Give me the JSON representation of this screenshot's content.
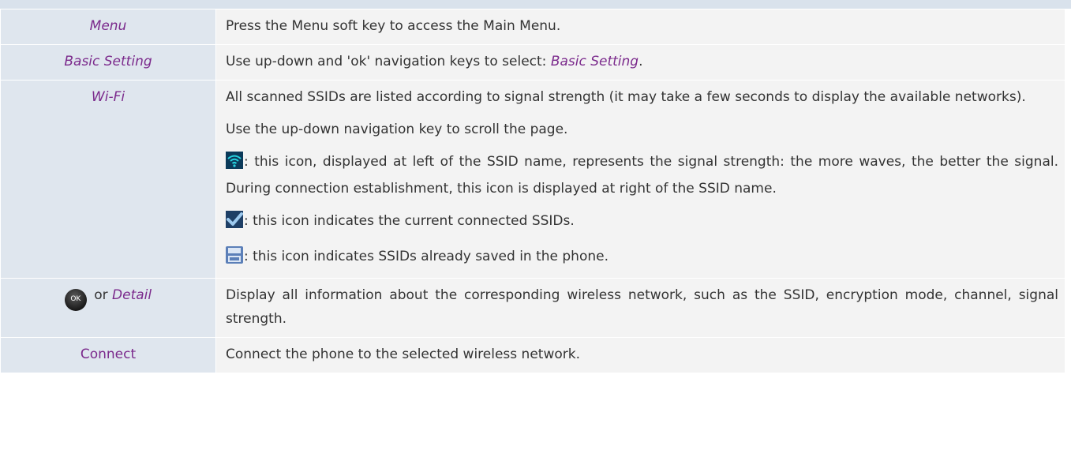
{
  "rows": {
    "menu": {
      "key": "Menu",
      "desc": "Press the Menu soft key to access the Main Menu."
    },
    "basic": {
      "key": "Basic Setting",
      "desc_prefix": "Use up-down and 'ok' navigation keys to select: ",
      "desc_emph": "Basic Setting",
      "desc_suffix": "."
    },
    "wifi": {
      "key": "Wi-Fi",
      "p1": "All scanned SSIDs are listed according to signal strength (it may take a few seconds to display the available networks).",
      "p2": "Use the up-down navigation key to scroll the page.",
      "p3": ": this icon, displayed at left of the SSID name, represents the signal strength: the more waves, the better the signal. During connection establishment, this icon is displayed at right of the SSID name.",
      "p4": ": this icon indicates the current connected SSIDs.",
      "p5": ": this icon indicates SSIDs already saved in the phone."
    },
    "detail": {
      "ok_label": "OK",
      "or": "or",
      "key": "Detail",
      "desc": "Display all information about the corresponding wireless network, such as the SSID, encryption mode, channel, signal strength."
    },
    "connect": {
      "key": "Connect",
      "desc": "Connect the phone to the selected wireless network."
    }
  },
  "icons": {
    "wifi_signal": "wifi-signal-icon",
    "connected_check": "checkmark-icon",
    "saved": "floppy-disk-icon",
    "ok_key": "ok-key-icon"
  },
  "colors": {
    "key_text": "#7b2a8c",
    "key_bg": "#dfe6ee",
    "desc_bg": "#f3f3f3",
    "top_strip": "#d9e2ec"
  }
}
